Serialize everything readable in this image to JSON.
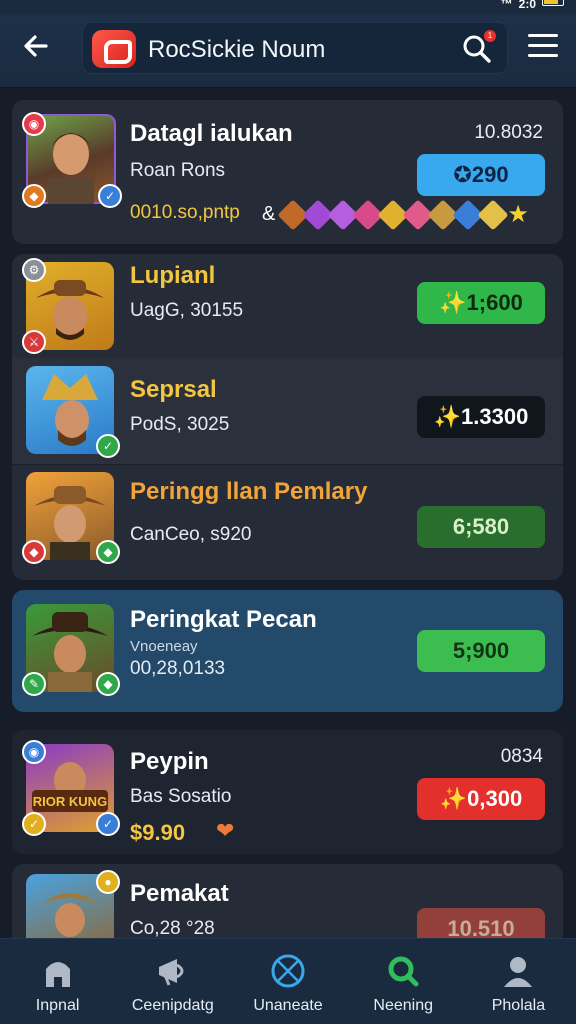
{
  "status_bar": {
    "time": "2:0"
  },
  "header": {
    "search_text": "RocSickie Noum",
    "notification_count": "1"
  },
  "rows": [
    {
      "title": "Datagl ialukan",
      "sub": "Roan Rons",
      "extra": "0010.so,pntp",
      "meta": "10.8032",
      "pill": "✪290"
    },
    {
      "title": "Lupianl",
      "sub": "UagG, 30155",
      "pill": "✨1;600"
    },
    {
      "title": "Seprsal",
      "sub": "PodS, 3025",
      "pill": "✨1.3300"
    },
    {
      "title": "Peringg llan Pemlary",
      "sub": "CanCeo, s920",
      "pill": "6;580"
    },
    {
      "title": "Peringkat Pecan",
      "sub_small": "Vnoeneay",
      "sub": "00,28,0133",
      "pill": "5;900"
    },
    {
      "title": "Peypin",
      "sub": "Bas Sosatio",
      "price": "$9.90",
      "meta": "0834",
      "pill": "✨0,300"
    },
    {
      "title": "Pemakat",
      "sub": "Co,28 °28",
      "pill": "10.510"
    }
  ],
  "nav": [
    {
      "label": "Inpnal",
      "icon": "home-icon"
    },
    {
      "label": "Ceenipdatg",
      "icon": "megaphone-icon"
    },
    {
      "label": "Unaneate",
      "icon": "compass-icon"
    },
    {
      "label": "Neening",
      "icon": "search-icon"
    },
    {
      "label": "Pholala",
      "icon": "profile-icon"
    }
  ],
  "colors": {
    "header_bg": "#1e3149",
    "card_bg": "#262c37",
    "card_highlight_bg": "#234a6b",
    "pill_blue": "#38a8ef",
    "pill_green": "#2fb74a",
    "pill_red": "#e3302c",
    "accent_gold": "#f2c63f"
  }
}
